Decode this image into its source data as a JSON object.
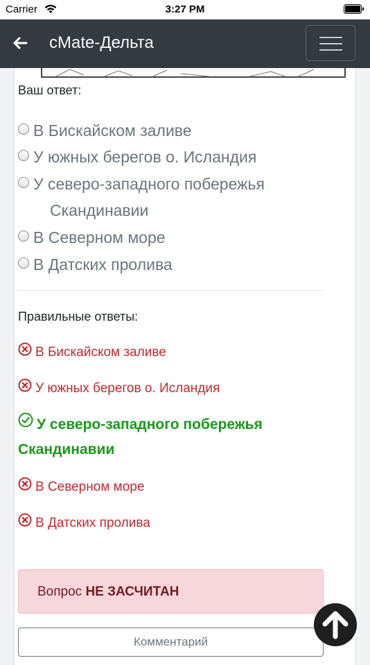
{
  "status_bar": {
    "carrier": "Carrier",
    "time": "3:27 PM"
  },
  "nav": {
    "title": "cMate-Дельта"
  },
  "quiz": {
    "your_answer_label": "Ваш ответ:",
    "options": [
      "В Бискайском заливе",
      "У южных берегов о. Исландия",
      "У северо-западного побережья",
      "Скандинавии",
      "В Северном море",
      "В Датских пролива"
    ],
    "correct_label": "Правильные ответы:",
    "answers": [
      {
        "text": "В Бискайском заливе",
        "status": "wrong"
      },
      {
        "text": "У южных берегов о. Исландия",
        "status": "wrong"
      },
      {
        "text": "У северо-западного побережья Скандинавии",
        "status": "correct"
      },
      {
        "text": "В Северном море",
        "status": "wrong"
      },
      {
        "text": "В Датских пролива",
        "status": "wrong"
      }
    ]
  },
  "result": {
    "prefix": "Вопрос ",
    "verdict": "НЕ ЗАСЧИТАН"
  },
  "comment_button": "Комментарий",
  "colors": {
    "navbar": "#343a40",
    "wrong": "#c6282f",
    "correct": "#1a9a1a",
    "alert_bg": "#f8d7da"
  },
  "icons": [
    "wifi-icon",
    "battery-icon",
    "back-arrow-icon",
    "hamburger-icon",
    "x-circle-icon",
    "check-circle-icon",
    "arrow-up-icon"
  ]
}
